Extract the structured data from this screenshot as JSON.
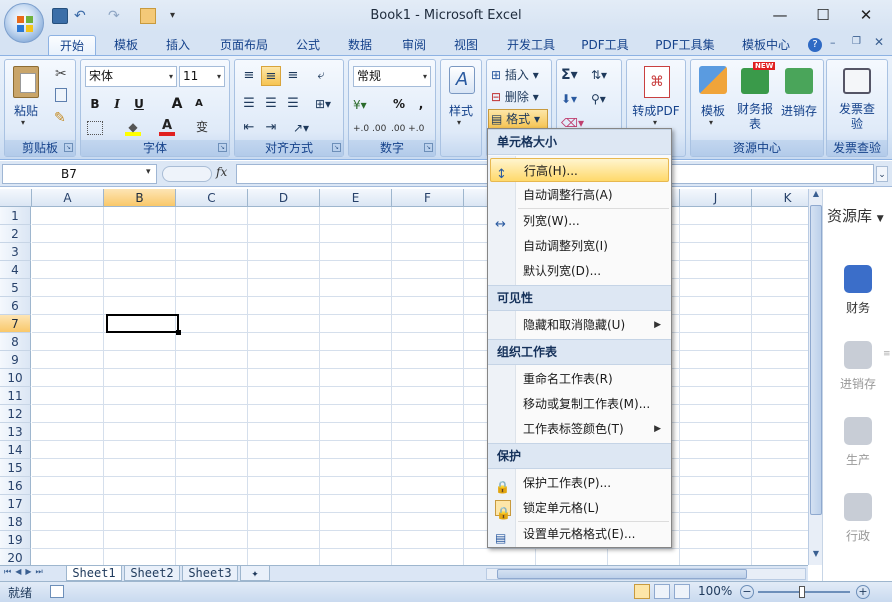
{
  "window": {
    "title": "Book1 - Microsoft Excel",
    "minimize": "—",
    "maximize": "☐",
    "close": "✕"
  },
  "tabs": [
    "开始",
    "模板",
    "插入",
    "页面布局",
    "公式",
    "数据",
    "审阅",
    "视图",
    "开发工具",
    "PDF工具",
    "PDF工具集",
    "模板中心"
  ],
  "ribbon": {
    "clipboard": {
      "label": "剪贴板",
      "paste": "粘贴"
    },
    "font": {
      "label": "字体",
      "name": "宋体",
      "size": "11",
      "bold": "B",
      "italic": "I",
      "underline": "U",
      "grow": "A",
      "shrink": "A",
      "pinyin": "变"
    },
    "align": {
      "label": "对齐方式"
    },
    "number": {
      "label": "数字",
      "format": "常规",
      "percent": "%",
      "comma": ",",
      "inc": "+.0 .00",
      "dec": ".00 +.0"
    },
    "styles": {
      "label": "样式"
    },
    "cells": {
      "insert": "插入",
      "delete": "删除",
      "format": "格式"
    },
    "editing": {
      "sum": "Σ"
    },
    "pdf": {
      "label": "转成PDF"
    },
    "resource": {
      "label": "资源中心",
      "template": "模板",
      "finance": "财务报表",
      "stock": "进销存",
      "new_badge": "NEW"
    },
    "invoice": {
      "label": "发票查验",
      "btn": "发票查验"
    }
  },
  "formula_bar": {
    "name_box": "B7",
    "fx": "fx",
    "content": ""
  },
  "grid": {
    "columns": [
      "A",
      "B",
      "C",
      "D",
      "E",
      "F",
      "G",
      "H",
      "I",
      "J",
      "K"
    ],
    "rows": [
      "1",
      "2",
      "3",
      "4",
      "5",
      "6",
      "7",
      "8",
      "9",
      "10",
      "11",
      "12",
      "13",
      "14",
      "15",
      "16",
      "17",
      "18",
      "19",
      "20"
    ],
    "active_cell": "B7"
  },
  "sheets": [
    "Sheet1",
    "Sheet2",
    "Sheet3"
  ],
  "status": {
    "ready": "就绪",
    "zoom": "100%"
  },
  "side_pane": {
    "title": "资源库",
    "items": [
      "财务",
      "进销存",
      "生产",
      "行政"
    ]
  },
  "context_menu": {
    "sections": [
      {
        "title": "单元格大小",
        "items": [
          {
            "label": "行高(H)...",
            "highlight": true
          },
          {
            "label": "自动调整行高(A)"
          },
          {
            "label": "列宽(W)..."
          },
          {
            "label": "自动调整列宽(I)"
          },
          {
            "label": "默认列宽(D)..."
          }
        ]
      },
      {
        "title": "可见性",
        "items": [
          {
            "label": "隐藏和取消隐藏(U)",
            "submenu": true
          }
        ]
      },
      {
        "title": "组织工作表",
        "items": [
          {
            "label": "重命名工作表(R)"
          },
          {
            "label": "移动或复制工作表(M)..."
          },
          {
            "label": "工作表标签颜色(T)",
            "submenu": true
          }
        ]
      },
      {
        "title": "保护",
        "items": [
          {
            "label": "保护工作表(P)..."
          },
          {
            "label": "锁定单元格(L)"
          },
          {
            "label": "设置单元格格式(E)..."
          }
        ]
      }
    ]
  },
  "colors": {
    "accent": "#15428b",
    "highlight": "#ffd96b",
    "ribbon": "#dbe8f7"
  }
}
